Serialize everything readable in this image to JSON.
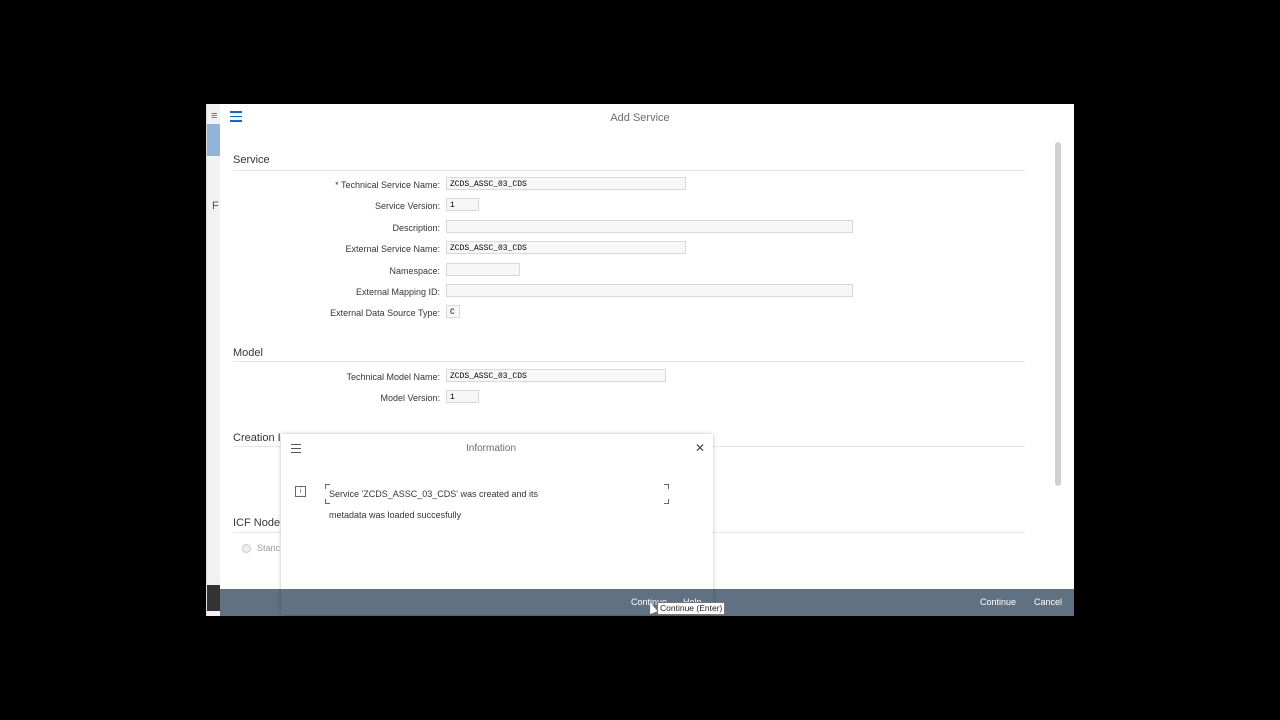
{
  "window": {
    "title": "Add Service"
  },
  "background": {
    "letter": "F"
  },
  "service_section": {
    "title": "Service",
    "fields": [
      {
        "label": "* Technical Service Name:",
        "value": "ZCDS_ASSC_03_CDS"
      },
      {
        "label": "Service Version:",
        "value": "1"
      },
      {
        "label": "Description:",
        "value": ""
      },
      {
        "label": "External Service Name:",
        "value": "ZCDS_ASSC_03_CDS"
      },
      {
        "label": "Namespace:",
        "value": ""
      },
      {
        "label": "External Mapping ID:",
        "value": ""
      },
      {
        "label": "External Data Source Type:",
        "value": "C"
      }
    ]
  },
  "model_section": {
    "title": "Model",
    "fields": [
      {
        "label": "Technical Model Name:",
        "value": "ZCDS_ASSC_03_CDS"
      },
      {
        "label": "Model Version:",
        "value": "1"
      }
    ]
  },
  "creation_section": {
    "title": "Creation I"
  },
  "icf_section": {
    "title": "ICF Node",
    "option_label": "Stanc"
  },
  "footer": {
    "continue_label": "Continue",
    "cancel_label": "Cancel"
  },
  "info_dialog": {
    "title": "Information",
    "message_line1": "Service 'ZCDS_ASSC_03_CDS' was created and its",
    "message_line2": "metadata was loaded succesfully",
    "continue_label": "Continue",
    "help_label": "Help"
  },
  "tooltip": {
    "text": "Continue   (Enter)"
  }
}
